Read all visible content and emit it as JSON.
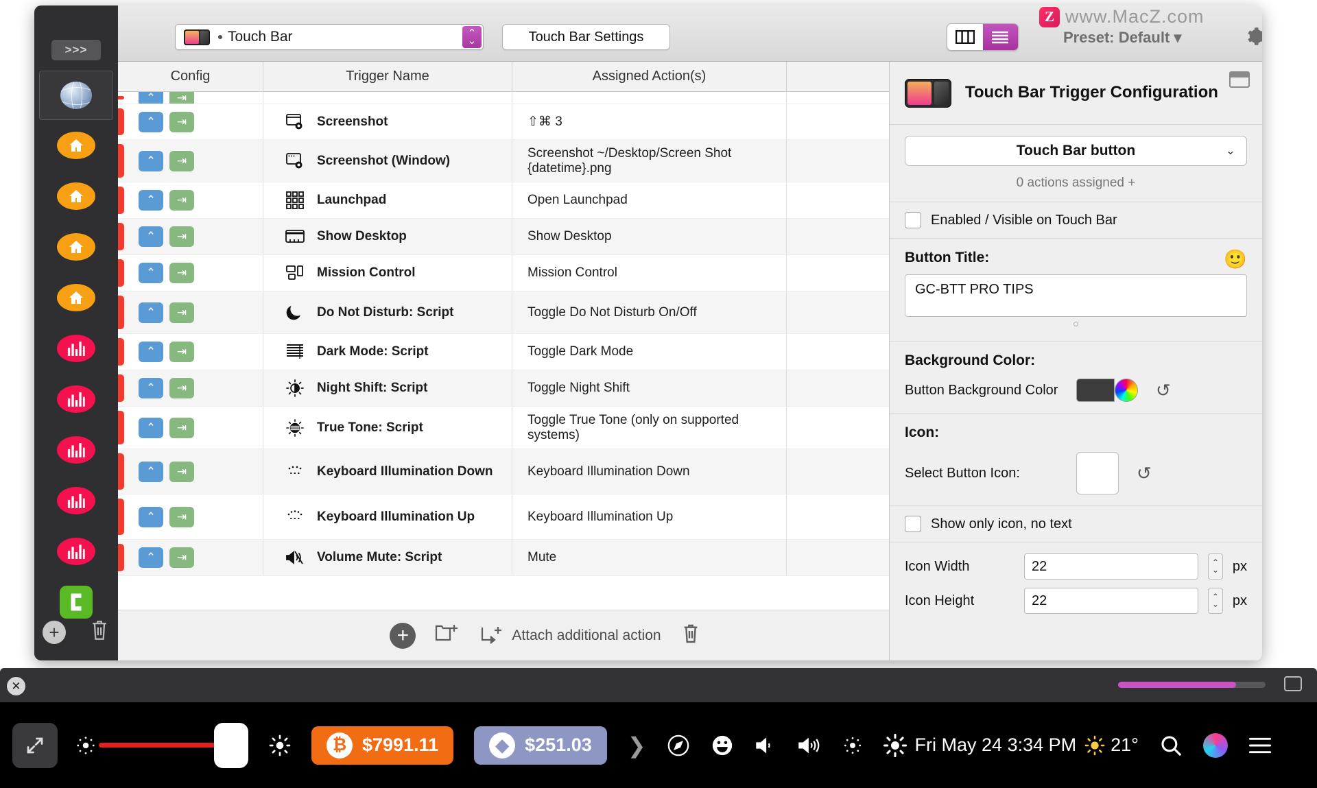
{
  "watermark": {
    "logo": "Z",
    "text": "www.MacZ.com"
  },
  "titlebar": {
    "preset_name": "Touch Bar",
    "settings_button": "Touch Bar Settings",
    "preset_label": "Preset: Default ▾",
    "icons": {
      "gear": "gear-icon",
      "columns": "column-view-icon",
      "list": "list-view-icon"
    }
  },
  "sidebar": {
    "expander": ">>>",
    "items": [
      {
        "icon": "globe-icon",
        "kind": "globe",
        "selected": true
      },
      {
        "icon": "home-icon",
        "kind": "orange"
      },
      {
        "icon": "home-icon",
        "kind": "orange"
      },
      {
        "icon": "home-icon",
        "kind": "orange"
      },
      {
        "icon": "home-icon",
        "kind": "orange"
      },
      {
        "icon": "chart-icon",
        "kind": "pink"
      },
      {
        "icon": "chart-icon",
        "kind": "pink"
      },
      {
        "icon": "chart-icon",
        "kind": "pink"
      },
      {
        "icon": "chart-icon",
        "kind": "pink"
      },
      {
        "icon": "chart-icon",
        "kind": "pink"
      },
      {
        "icon": "app-icon",
        "kind": "green"
      }
    ],
    "add_label": "+",
    "delete_label": "trash-icon"
  },
  "table": {
    "columns": [
      "Config",
      "Trigger Name",
      "Assigned Action(s)",
      ""
    ],
    "rows": [
      {
        "name": "Screenshot",
        "action": "⇧⌘ 3",
        "icon": "screenshot-icon"
      },
      {
        "name": "Screenshot (Window)",
        "action": "Screenshot ~/Desktop/Screen Shot {datetime}.png",
        "icon": "screenshot-window-icon"
      },
      {
        "name": "Launchpad",
        "action": "Open Launchpad",
        "icon": "launchpad-icon"
      },
      {
        "name": "Show Desktop",
        "action": "Show Desktop",
        "icon": "show-desktop-icon"
      },
      {
        "name": "Mission Control",
        "action": "Mission Control",
        "icon": "mission-control-icon"
      },
      {
        "name": "Do Not Disturb: Script",
        "action": "Toggle Do Not Disturb On/Off",
        "icon": "moon-icon"
      },
      {
        "name": "Dark Mode: Script",
        "action": "Toggle Dark Mode",
        "icon": "blinds-icon"
      },
      {
        "name": "Night Shift: Script",
        "action": "Toggle Night Shift",
        "icon": "night-shift-icon"
      },
      {
        "name": "True Tone: Script",
        "action": "Toggle True Tone (only on supported systems)",
        "icon": "true-tone-icon"
      },
      {
        "name": "Keyboard Illumination Down",
        "action": "Keyboard Illumination Down",
        "icon": "kbd-illum-down-icon"
      },
      {
        "name": "Keyboard Illumination Up",
        "action": "Keyboard Illumination Up",
        "icon": "kbd-illum-up-icon"
      },
      {
        "name": "Volume Mute: Script",
        "action": "Mute",
        "icon": "volume-mute-icon"
      }
    ],
    "footer": {
      "add": "+",
      "new_group": "new-group-icon",
      "attach_label": "Attach additional action",
      "delete": "trash-icon"
    }
  },
  "panel": {
    "title": "Touch Bar Trigger Configuration",
    "type_select": "Touch Bar button",
    "actions_assigned": "0 actions assigned +",
    "enabled_checkbox": "Enabled / Visible on Touch Bar",
    "button_title_label": "Button Title:",
    "button_title_value": "GC-BTT PRO TIPS",
    "background_label": "Background Color:",
    "background_field_label": "Button Background Color",
    "icon_label": "Icon:",
    "select_icon_label": "Select Button Icon:",
    "show_only_icon": "Show only icon, no text",
    "icon_width_label": "Icon Width",
    "icon_width_value": "22",
    "icon_height_label": "Icon Height",
    "icon_height_value": "22",
    "px_unit": "px",
    "emoji": "🙂"
  },
  "touchbar": {
    "bitcoin": "$7991.11",
    "bitcoin_symbol": "₿",
    "ethereum": "$251.03",
    "ethereum_symbol": "◆",
    "clock": "Fri May 24 3:34 PM",
    "temperature": "21°",
    "icons": [
      "expand-icon",
      "brightness-low-icon",
      "brightness-high-icon",
      "chevron-right-icon",
      "safari-icon",
      "emoji-icon",
      "volume-down-icon",
      "volume-up-icon",
      "brightness-low-icon",
      "brightness-high-icon",
      "sun-icon",
      "search-icon",
      "siri-icon",
      "list-icon"
    ]
  }
}
